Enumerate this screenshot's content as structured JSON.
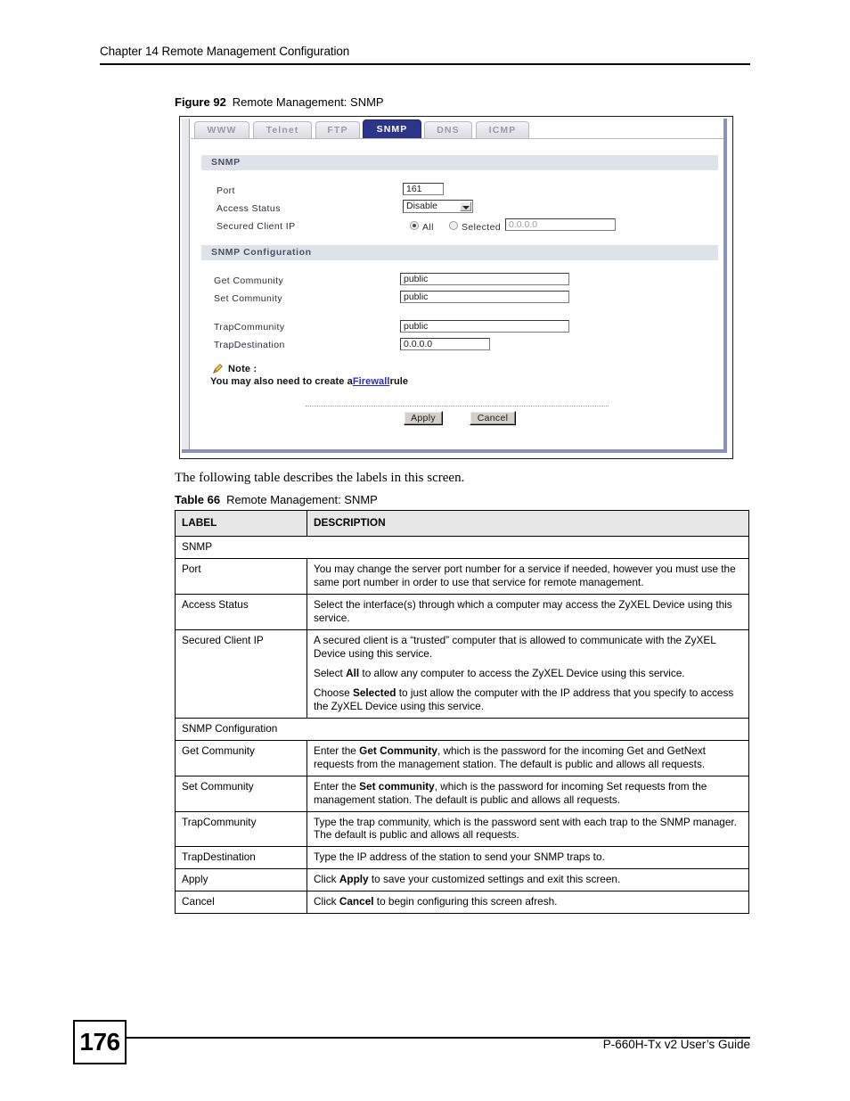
{
  "header": {
    "chapter": "Chapter 14 Remote Management Configuration"
  },
  "figure": {
    "number": "Figure 92",
    "title": "Remote Management: SNMP"
  },
  "screen": {
    "tabs": [
      {
        "label": "WWW",
        "active": false
      },
      {
        "label": "Telnet",
        "active": false
      },
      {
        "label": "FTP",
        "active": false
      },
      {
        "label": "SNMP",
        "active": true
      },
      {
        "label": "DNS",
        "active": false
      },
      {
        "label": "ICMP",
        "active": false
      }
    ],
    "section_snmp": {
      "title": "SNMP",
      "port_label": "Port",
      "port_value": "161",
      "access_status_label": "Access Status",
      "access_status_value": "Disable",
      "secured_client_ip_label": "Secured Client IP",
      "radio_all_label": "All",
      "radio_selected_label": "Selected",
      "selected_ip_value": "0.0.0.0"
    },
    "section_snmp_config": {
      "title": "SNMP Configuration",
      "get_community_label": "Get Community",
      "get_community_value": "public",
      "set_community_label": "Set Community",
      "set_community_value": "public",
      "trap_community_label": "TrapCommunity",
      "trap_community_value": "public",
      "trap_destination_label": "TrapDestination",
      "trap_destination_value": "0.0.0.0"
    },
    "note": {
      "title": "Note :",
      "text_before": "You may also need to create a",
      "link": "Firewall",
      "text_after": "rule"
    },
    "buttons": {
      "apply": "Apply",
      "cancel": "Cancel"
    }
  },
  "intro_text": "The following table describes the labels in this screen.",
  "table": {
    "number": "Table 66",
    "title": "Remote Management: SNMP",
    "columns": [
      "LABEL",
      "DESCRIPTION"
    ],
    "rows": [
      {
        "type": "section",
        "label": "SNMP"
      },
      {
        "type": "row",
        "label": "Port",
        "description": "You may change the server port number for a service if needed, however you must use the same port number in order to use that service for remote management."
      },
      {
        "type": "row",
        "label": "Access Status",
        "description": "Select the interface(s) through which a computer may access the ZyXEL Device using this service."
      },
      {
        "type": "row-rich",
        "label": "Secured Client IP",
        "paragraphs": [
          [
            {
              "t": "A secured client is a “trusted” computer that is allowed to communicate with the ZyXEL Device using this service."
            }
          ],
          [
            {
              "t": "Select "
            },
            {
              "t": "All",
              "b": true
            },
            {
              "t": " to allow any computer to access the ZyXEL Device using this service."
            }
          ],
          [
            {
              "t": "Choose "
            },
            {
              "t": "Selected",
              "b": true
            },
            {
              "t": " to just allow the computer with the IP address that you specify to access the ZyXEL Device using this service."
            }
          ]
        ]
      },
      {
        "type": "section",
        "label": "SNMP Configuration"
      },
      {
        "type": "row-rich",
        "label": "Get Community",
        "paragraphs": [
          [
            {
              "t": "Enter the "
            },
            {
              "t": "Get Community",
              "b": true
            },
            {
              "t": ", which is the password for the incoming Get and GetNext requests from the management station. The default is public and allows all requests."
            }
          ]
        ]
      },
      {
        "type": "row-rich",
        "label": "Set Community",
        "paragraphs": [
          [
            {
              "t": "Enter the "
            },
            {
              "t": "Set community",
              "b": true
            },
            {
              "t": ", which is the password for incoming Set requests from the management station. The default is public and allows all requests."
            }
          ]
        ]
      },
      {
        "type": "row",
        "label": "TrapCommunity",
        "description": "Type the trap community, which is the password sent with each trap to the SNMP manager. The default is public and allows all requests."
      },
      {
        "type": "row",
        "label": "TrapDestination",
        "description": "Type the IP address of the station to send your SNMP traps to."
      },
      {
        "type": "row-rich",
        "label": "Apply",
        "paragraphs": [
          [
            {
              "t": "Click "
            },
            {
              "t": "Apply",
              "b": true
            },
            {
              "t": " to save your customized settings and exit this screen."
            }
          ]
        ]
      },
      {
        "type": "row-rich",
        "label": "Cancel",
        "paragraphs": [
          [
            {
              "t": "Click "
            },
            {
              "t": "Cancel",
              "b": true
            },
            {
              "t": " to begin configuring this screen afresh."
            }
          ]
        ]
      }
    ]
  },
  "footer": {
    "page_number": "176",
    "guide": "P-660H-Tx v2 User’s Guide"
  }
}
